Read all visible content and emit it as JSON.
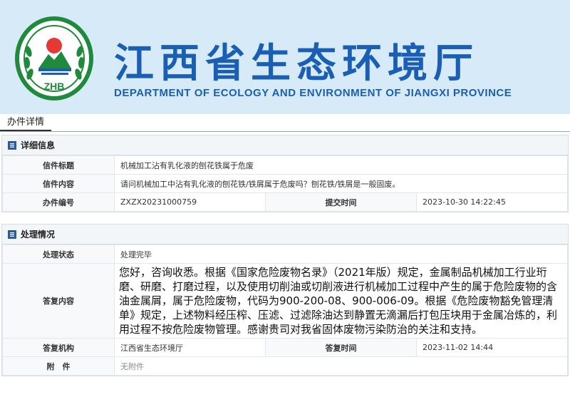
{
  "header": {
    "title_cn": "江西省生态环境厅",
    "title_en": "DEPARTMENT OF ECOLOGY AND ENVIRONMENT OF JIANGXI PROVINCE",
    "logo_text": "ZHB"
  },
  "tab": {
    "label": "办件详情"
  },
  "detail": {
    "section_title": "详细信息",
    "rows": {
      "title_label": "信件标题",
      "title_value": "机械加工沾有乳化液的刨花铁属于危废",
      "content_label": "信件内容",
      "content_value": "请问机械加工中沾有乳化液的刨花铁/铁屑属于危废吗？刨花铁/铁屑是一般固废。",
      "id_label": "办件编号",
      "id_value": "ZXZX20231000759",
      "submit_label": "提交时间",
      "submit_value": "2023-10-30 14:22:45"
    }
  },
  "process": {
    "section_title": "处理情况",
    "rows": {
      "status_label": "处理状态",
      "status_value": "处理完毕",
      "reply_label": "答复内容",
      "reply_value": "您好，咨询收悉。根据《国家危险废物名录》（2021年版）规定，金属制品机械加工行业珩磨、研磨、打磨过程，以及使用切削油或切削液进行机械加工过程中产生的属于危险废物的含油金属屑，属于危险废物，代码为900-200-08、900-006-09。根据《危险废物豁免管理清单》规定，上述物料经压榨、压滤、过滤除油达到静置无滴漏后打包压块用于金属冶炼的，利用过程不按危险废物管理。感谢贵司对我省固体废物污染防治的关注和支持。",
      "org_label": "答复机构",
      "org_value": "江西省生态环境厅",
      "reply_time_label": "答复时间",
      "reply_time_value": "2023-11-02 14:44",
      "attach_label": "附　件",
      "attach_value": "无附件"
    }
  },
  "colors": {
    "brand_blue": "#1a5fb4",
    "banner_bg": "#d6eaf8",
    "logo_green": "#1f8a3b"
  },
  "icons": {
    "section_icon": "list-icon"
  }
}
